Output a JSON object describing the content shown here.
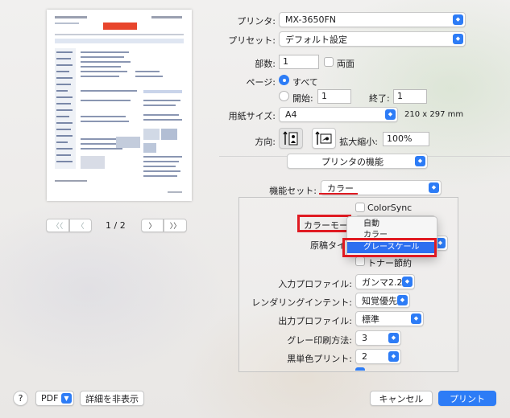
{
  "preview": {
    "page_indicator": "1 / 2",
    "nav_first": "〈〈",
    "nav_prev": "〈",
    "nav_next": "〉",
    "nav_last": "〉〉"
  },
  "printer": {
    "label": "プリンタ:",
    "value": "MX-3650FN"
  },
  "preset": {
    "label": "プリセット:",
    "value": "デフォルト設定"
  },
  "copies": {
    "label": "部数:",
    "value": "1",
    "duplex_label": "両面"
  },
  "pages": {
    "label": "ページ:",
    "all_label": "すべて",
    "from_label": "開始:",
    "from_value": "1",
    "to_label": "終了:",
    "to_value": "1"
  },
  "paper_size": {
    "label": "用紙サイズ:",
    "value": "A4",
    "dimensions": "210 x 297 mm"
  },
  "orientation": {
    "label": "方向:"
  },
  "scale": {
    "label": "拡大縮小:",
    "value": "100%"
  },
  "section_popup": {
    "value": "プリンタの機能"
  },
  "feature_set": {
    "label": "機能セット:",
    "value": "カラー"
  },
  "colorsync_label": "ColorSync",
  "color_mode": {
    "label": "カラーモード",
    "checkmark": "✓"
  },
  "color_mode_menu": [
    "自動",
    "カラー",
    "グレースケール"
  ],
  "original_type": {
    "label": "原稿タイプ"
  },
  "toner_save_label": "トナー節約",
  "input_profile": {
    "label": "入力プロファイル:",
    "value": "ガンマ2.2"
  },
  "rendering_intent": {
    "label": "レンダリングインテント:",
    "value": "知覚優先"
  },
  "output_profile": {
    "label": "出力プロファイル:",
    "value": "標準"
  },
  "gray_print_method": {
    "label": "グレー印刷方法:",
    "value": "3"
  },
  "black_print": {
    "label": "黒単色プリント:",
    "value": "2"
  },
  "footer": {
    "help": "?",
    "pdf": "PDF",
    "hide_details": "詳細を非表示",
    "cancel": "キャンセル",
    "print": "プリント"
  },
  "colors": {
    "accent": "#2d7cf6",
    "highlight_red": "#e01a22"
  }
}
